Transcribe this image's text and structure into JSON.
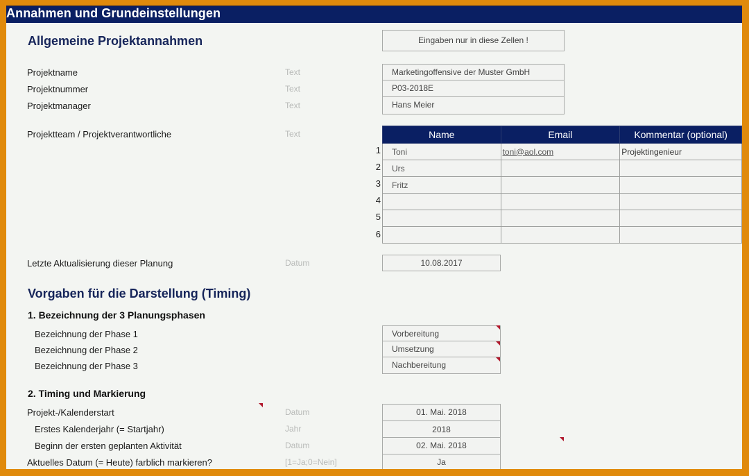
{
  "header": {
    "title": "Annahmen und Grundeinstellungen"
  },
  "general": {
    "heading": "Allgemeine Projektannahmen",
    "input_hint": "Eingaben nur in diese Zellen !",
    "fields": [
      {
        "label": "Projektname",
        "type": "Text",
        "value": "Marketingoffensive der Muster GmbH"
      },
      {
        "label": "Projektnummer",
        "type": "Text",
        "value": "P03-2018E"
      },
      {
        "label": "Projektmanager",
        "type": "Text",
        "value": "Hans Meier"
      }
    ],
    "team": {
      "label": "Projektteam / Projektverantwortliche",
      "type": "Text",
      "columns": [
        "Name",
        "Email",
        "Kommentar (optional)"
      ],
      "rows": [
        {
          "num": "1",
          "name": "Toni",
          "email": "toni@aol.com",
          "comment": "Projektingenieur"
        },
        {
          "num": "2",
          "name": "Urs",
          "email": "",
          "comment": ""
        },
        {
          "num": "3",
          "name": "Fritz",
          "email": "",
          "comment": ""
        },
        {
          "num": "4",
          "name": "",
          "email": "",
          "comment": ""
        },
        {
          "num": "5",
          "name": "",
          "email": "",
          "comment": ""
        },
        {
          "num": "6",
          "name": "",
          "email": "",
          "comment": ""
        }
      ]
    },
    "last_update": {
      "label": "Letzte Aktualisierung dieser Planung",
      "type": "Datum",
      "value": "10.08.2017"
    }
  },
  "timing": {
    "heading": "Vorgaben für die Darstellung (Timing)",
    "phases": {
      "heading": "1. Bezeichnung der 3 Planungsphasen",
      "items": [
        {
          "label": "Bezeichnung der Phase 1",
          "value": "Vorbereitung"
        },
        {
          "label": "Bezeichnung der Phase 2",
          "value": "Umsetzung"
        },
        {
          "label": "Bezeichnung der Phase 3",
          "value": "Nachbereitung"
        }
      ]
    },
    "marking": {
      "heading": "2. Timing und Markierung",
      "items": [
        {
          "label": "Projekt-/Kalenderstart",
          "type": "Datum",
          "value": "01. Mai. 2018"
        },
        {
          "label": "Erstes Kalenderjahr (= Startjahr)",
          "type": "Jahr",
          "value": "2018"
        },
        {
          "label": "Beginn der ersten geplanten Aktivität",
          "type": "Datum",
          "value": "02. Mai. 2018"
        },
        {
          "label": "Aktuelles Datum (= Heute) farblich markieren?",
          "type": "[1=Ja;0=Nein]",
          "value": "Ja"
        }
      ]
    }
  }
}
